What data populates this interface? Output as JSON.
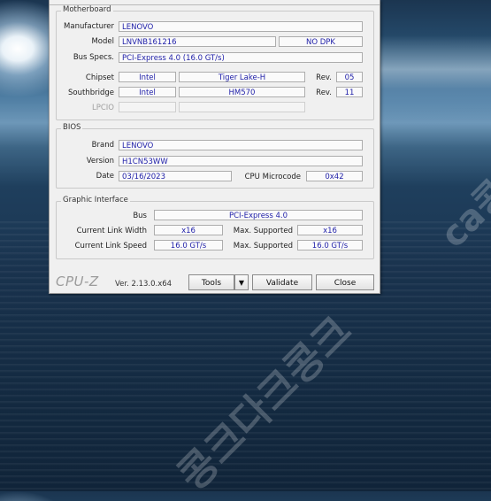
{
  "background": {
    "watermark_main": "콩크다크콩크",
    "watermark_side": "ca콩"
  },
  "motherboard": {
    "title": "Motherboard",
    "manufacturer_label": "Manufacturer",
    "manufacturer": "LENOVO",
    "model_label": "Model",
    "model": "LNVNB161216",
    "model_extra": "NO DPK",
    "bus_label": "Bus Specs.",
    "bus": "PCI-Express 4.0 (16.0 GT/s)",
    "chipset_label": "Chipset",
    "chipset_vendor": "Intel",
    "chipset_name": "Tiger Lake-H",
    "chipset_rev_label": "Rev.",
    "chipset_rev": "05",
    "southbridge_label": "Southbridge",
    "southbridge_vendor": "Intel",
    "southbridge_name": "HM570",
    "southbridge_rev_label": "Rev.",
    "southbridge_rev": "11",
    "lpcio_label": "LPCIO"
  },
  "bios": {
    "title": "BIOS",
    "brand_label": "Brand",
    "brand": "LENOVO",
    "version_label": "Version",
    "version": "H1CN53WW",
    "date_label": "Date",
    "date": "03/16/2023",
    "microcode_label": "CPU Microcode",
    "microcode": "0x42"
  },
  "graphic": {
    "title": "Graphic Interface",
    "bus_label": "Bus",
    "bus": "PCI-Express 4.0",
    "link_width_label": "Current Link Width",
    "link_width": "x16",
    "max_width_label": "Max. Supported",
    "max_width": "x16",
    "link_speed_label": "Current Link Speed",
    "link_speed": "16.0 GT/s",
    "max_speed_label": "Max. Supported",
    "max_speed": "16.0 GT/s"
  },
  "footer": {
    "brand": "CPU-Z",
    "version": "Ver. 2.13.0.x64",
    "tools": "Tools",
    "validate": "Validate",
    "close": "Close",
    "dropdown_glyph": "▼"
  }
}
